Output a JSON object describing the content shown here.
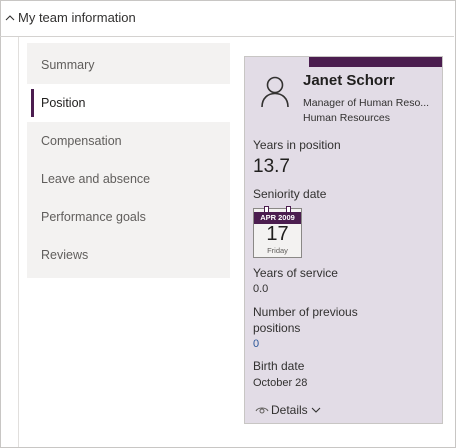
{
  "section": {
    "title": "My team information",
    "collapse_icon": "chevron-up-icon"
  },
  "nav": {
    "items": [
      {
        "label": "Summary",
        "active": false
      },
      {
        "label": "Position",
        "active": true
      },
      {
        "label": "Compensation",
        "active": false
      },
      {
        "label": "Leave and absence",
        "active": false
      },
      {
        "label": "Performance goals",
        "active": false
      },
      {
        "label": "Reviews",
        "active": false
      }
    ]
  },
  "card": {
    "accent": "#4b1d4f",
    "background": "#e2dce6",
    "avatar_icon": "person-icon",
    "name": "Janet Schorr",
    "job_title": "Manager of Human Reso...",
    "department": "Human Resources",
    "fields": {
      "years_in_position_label": "Years in position",
      "years_in_position_value": "13.7",
      "seniority_date_label": "Seniority date",
      "seniority_month_year": "APR 2009",
      "seniority_day": "17",
      "seniority_weekday": "Friday",
      "years_of_service_label": "Years of service",
      "years_of_service_value": "0.0",
      "previous_positions_label_line1": "Number of previous",
      "previous_positions_label_line2": "positions",
      "previous_positions_value": "0",
      "birth_date_label": "Birth date",
      "birth_date_value": "October 28"
    },
    "details_label": "Details"
  }
}
